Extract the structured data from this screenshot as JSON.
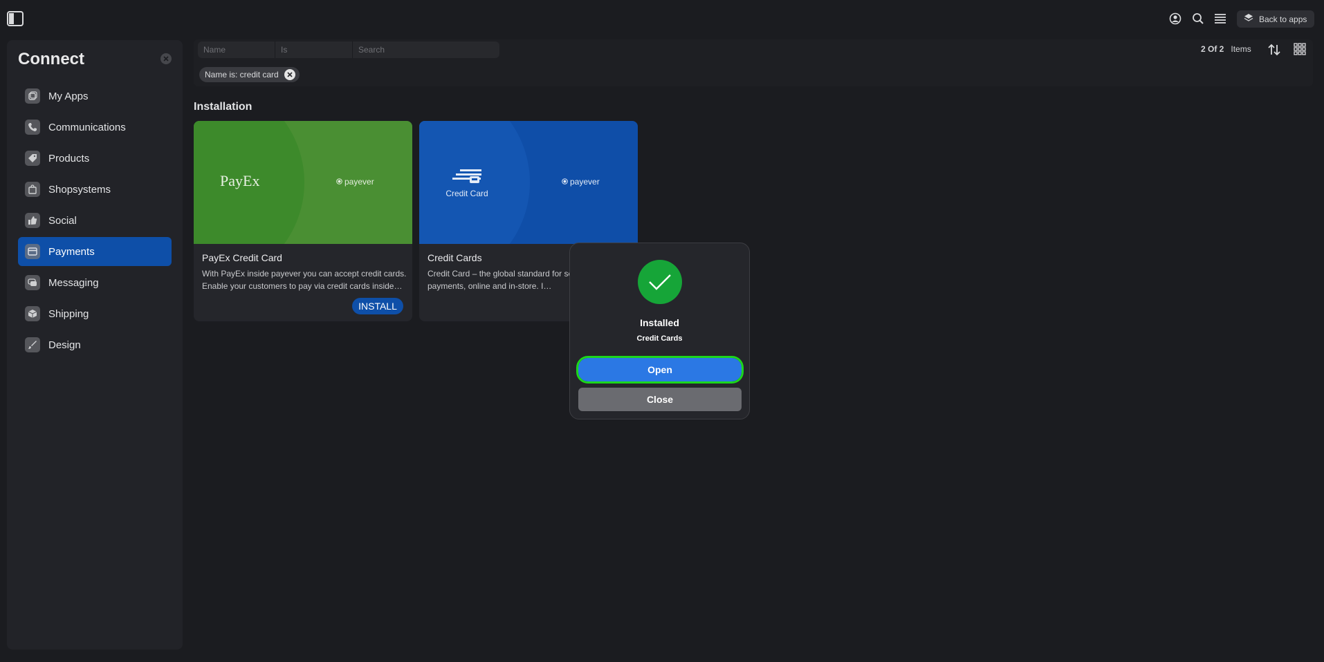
{
  "topbar": {
    "back_to_apps_label": "Back to apps",
    "icons": [
      "sidebar-toggle-icon",
      "account-icon",
      "search-icon",
      "menu-icon",
      "layers-icon"
    ]
  },
  "sidebar": {
    "title": "Connect",
    "items": [
      {
        "label": "My Apps",
        "icon": "apps-icon",
        "active": false
      },
      {
        "label": "Communications",
        "icon": "phone-icon",
        "active": false
      },
      {
        "label": "Products",
        "icon": "tag-icon",
        "active": false
      },
      {
        "label": "Shopsystems",
        "icon": "bag-icon",
        "active": false
      },
      {
        "label": "Social",
        "icon": "thumbs-up-icon",
        "active": false
      },
      {
        "label": "Payments",
        "icon": "card-icon",
        "active": true
      },
      {
        "label": "Messaging",
        "icon": "chat-icon",
        "active": false
      },
      {
        "label": "Shipping",
        "icon": "box-icon",
        "active": false
      },
      {
        "label": "Design",
        "icon": "brush-icon",
        "active": false
      }
    ]
  },
  "filter": {
    "field_name_placeholder": "Name",
    "field_is_placeholder": "Is",
    "field_search_placeholder": "Search",
    "chip_label": "Name is: credit card",
    "count_label": "2 Of 2",
    "items_label": "Items"
  },
  "section": {
    "title": "Installation"
  },
  "cards": [
    {
      "title": "PayEx Credit Card",
      "description": "With PayEx inside payever you can accept credit cards. Enable your customers to pay via credit cards inside…",
      "logo_text": "PayEx",
      "brand_text": "payever",
      "button_label": "INSTALL",
      "hero_color": "#3f8a2e"
    },
    {
      "title": "Credit Cards",
      "description": "Credit Card – the global standard for se… instant payments, online and in-store. I…",
      "logo_text": "Credit Card",
      "brand_text": "payever",
      "hero_color": "#0d4aa6"
    }
  ],
  "modal": {
    "title": "Installed",
    "subtitle": "Credit Cards",
    "open_label": "Open",
    "close_label": "Close",
    "success_color": "#16a538"
  },
  "colors": {
    "accent": "#0e4fa8",
    "background": "#1b1c20"
  }
}
